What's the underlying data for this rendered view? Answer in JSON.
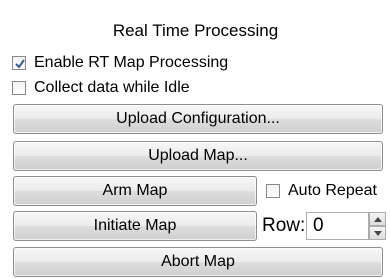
{
  "panel": {
    "title": "Real Time Processing"
  },
  "checkboxes": {
    "enable_rt": {
      "label": "Enable RT Map Processing",
      "checked": true
    },
    "collect_idle": {
      "label": "Collect data while Idle",
      "checked": false
    },
    "auto_repeat": {
      "label": "Auto Repeat",
      "checked": false
    }
  },
  "buttons": {
    "upload_configuration": "Upload Configuration...",
    "upload_map": "Upload Map...",
    "arm_map": "Arm Map",
    "initiate_map": "Initiate Map",
    "abort_map": "Abort Map"
  },
  "row": {
    "label": "Row:",
    "value": "0"
  },
  "icons": {
    "check": "checkmark-icon",
    "spin_up": "spin-up-icon",
    "spin_down": "spin-down-icon"
  },
  "colors": {
    "check_mark": "#3b5a8c",
    "button_border": "#8e8f8f"
  }
}
